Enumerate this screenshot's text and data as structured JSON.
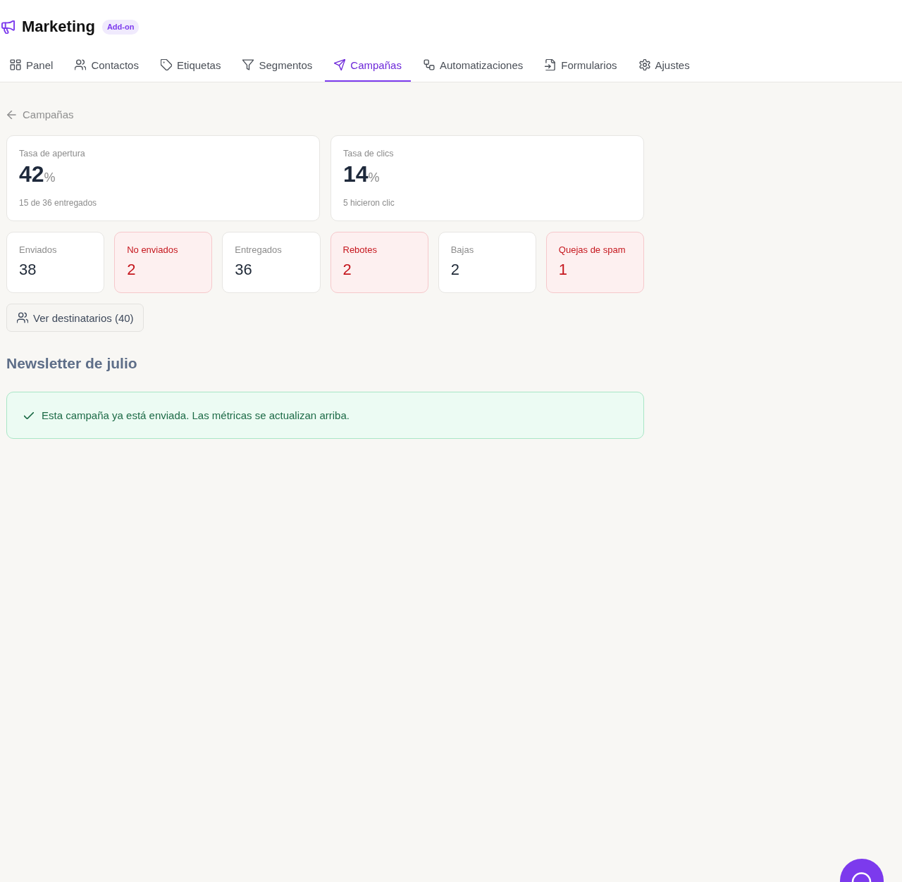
{
  "header": {
    "title": "Marketing",
    "badge": "Add-on"
  },
  "tabs": [
    {
      "label": "Panel",
      "selected": false
    },
    {
      "label": "Contactos",
      "selected": false
    },
    {
      "label": "Etiquetas",
      "selected": false
    },
    {
      "label": "Segmentos",
      "selected": false
    },
    {
      "label": "Campañas",
      "selected": true
    },
    {
      "label": "Automatizaciones",
      "selected": false
    },
    {
      "label": "Formularios",
      "selected": false
    },
    {
      "label": "Ajustes",
      "selected": false
    }
  ],
  "back_link": {
    "label": "Campañas"
  },
  "rate_cards": [
    {
      "label": "Tasa de apertura",
      "value": "42",
      "unit": "%",
      "detail": "15 de 36 entregados"
    },
    {
      "label": "Tasa de clics",
      "value": "14",
      "unit": "%",
      "detail": "5 hicieron clic"
    }
  ],
  "stat_cards": [
    {
      "label": "Enviados",
      "value": "38",
      "alert": false
    },
    {
      "label": "No enviados",
      "value": "2",
      "alert": true
    },
    {
      "label": "Entregados",
      "value": "36",
      "alert": false
    },
    {
      "label": "Rebotes",
      "value": "2",
      "alert": true
    },
    {
      "label": "Bajas",
      "value": "2",
      "alert": false
    },
    {
      "label": "Quejas de spam",
      "value": "1",
      "alert": true
    }
  ],
  "recipients_button": {
    "label": "Ver destinatarios (40)"
  },
  "campaign_title": "Newsletter de julio",
  "notice": {
    "kind": "success",
    "text": "Esta campaña ya está enviada. Las métricas se actualizan arriba."
  }
}
